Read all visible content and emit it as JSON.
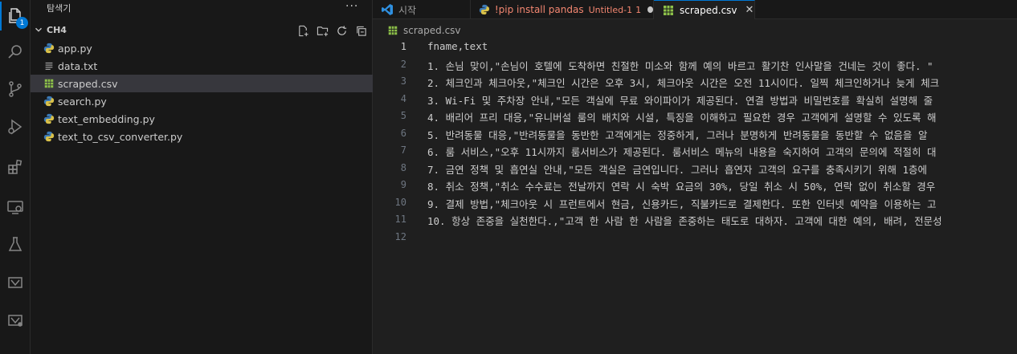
{
  "activity_bar": {
    "explorer_badge": "1",
    "colors": {
      "accent": "#0078d4"
    }
  },
  "sidebar": {
    "title": "탐색기",
    "more": "···",
    "folder": "CH4",
    "files": [
      {
        "name": "app.py",
        "type": "python"
      },
      {
        "name": "data.txt",
        "type": "text"
      },
      {
        "name": "scraped.csv",
        "type": "csv",
        "selected": true
      },
      {
        "name": "search.py",
        "type": "python"
      },
      {
        "name": "text_embedding.py",
        "type": "python"
      },
      {
        "name": "text_to_csv_converter.py",
        "type": "python"
      }
    ]
  },
  "tabs": [
    {
      "label": "시작",
      "icon": "vscode-icon"
    },
    {
      "label": "!pip install pandas",
      "sub": "Untitled-1",
      "badge": "1",
      "icon": "python-icon",
      "dirty": true
    },
    {
      "label": "scraped.csv",
      "icon": "csv-icon",
      "active": true,
      "close": "✕"
    }
  ],
  "breadcrumb": {
    "file": "scraped.csv"
  },
  "editor": {
    "lines": [
      {
        "n": "1",
        "text": "fname,text"
      },
      {
        "n": "2",
        "text": "1. 손님 맞이,\"손님이 호텔에 도착하면 친절한 미소와 함께 예의 바르고 활기찬 인사말을 건네는 것이 좋다. \""
      },
      {
        "n": "3",
        "text": "2. 체크인과 체크아웃,\"체크인 시간은 오후 3시, 체크아웃 시간은 오전 11시이다. 일찍 체크인하거나 늦게 체크"
      },
      {
        "n": "4",
        "text": "3. Wi-Fi 및 주차장 안내,\"모든 객실에 무료 와이파이가 제공된다. 연결 방법과 비밀번호를 확실히 설명해 줄"
      },
      {
        "n": "5",
        "text": "4. 배리어 프리 대응,\"유니버설 룸의 배치와 시설, 특징을 이해하고 필요한 경우 고객에게 설명할 수 있도록 해"
      },
      {
        "n": "6",
        "text": "5. 반려동물 대응,\"반려동물을 동반한 고객에게는 정중하게, 그러나 분명하게 반려동물을 동반할 수 없음을 알"
      },
      {
        "n": "7",
        "text": "6. 룸 서비스,\"오후 11시까지 룸서비스가 제공된다. 룸서비스 메뉴의 내용을 숙지하여 고객의 문의에 적절히 대"
      },
      {
        "n": "8",
        "text": "7. 금연 정책 및 흡연실 안내,\"모든 객실은 금연입니다. 그러나 흡연자 고객의 요구를 충족시키기 위해 1층에"
      },
      {
        "n": "9",
        "text": "8. 취소 정책,\"취소 수수료는 전날까지 연락 시 숙박 요금의 30%, 당일 취소 시 50%, 연락 없이 취소할 경우"
      },
      {
        "n": "10",
        "text": "9. 결제 방법,\"체크아웃 시 프런트에서 현금, 신용카드, 직불카드로 결제한다. 또한 인터넷 예약을 이용하는 고"
      },
      {
        "n": "11",
        "text": "10. 항상 존중을 실천한다.,\"고객 한 사람 한 사람을 존중하는 태도로 대하자. 고객에 대한 예의, 배려, 전문성"
      },
      {
        "n": "12",
        "text": ""
      }
    ]
  }
}
